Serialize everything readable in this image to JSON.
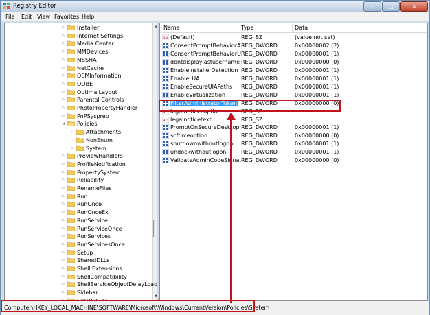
{
  "window": {
    "title": "Registry Editor"
  },
  "menu": [
    "File",
    "Edit",
    "View",
    "Favorites",
    "Help"
  ],
  "tree": [
    {
      "label": "Installer",
      "level": 0
    },
    {
      "label": "Internet Settings",
      "level": 0
    },
    {
      "label": "Media Center",
      "level": 0
    },
    {
      "label": "MMDevices",
      "level": 0
    },
    {
      "label": "MSSHA",
      "level": 0
    },
    {
      "label": "NetCache",
      "level": 0
    },
    {
      "label": "OEMInformation",
      "level": 0
    },
    {
      "label": "OOBE",
      "level": 0
    },
    {
      "label": "OptimalLayout",
      "level": 0
    },
    {
      "label": "Parental Controls",
      "level": 0
    },
    {
      "label": "PhotoPropertyHandler",
      "level": 0
    },
    {
      "label": "PnPSysprep",
      "level": 0
    },
    {
      "label": "Policies",
      "level": 0,
      "expanded": true
    },
    {
      "label": "Attachments",
      "level": 1
    },
    {
      "label": "NonEnum",
      "level": 1
    },
    {
      "label": "System",
      "level": 1
    },
    {
      "label": "PreviewHandlers",
      "level": 0
    },
    {
      "label": "ProfileNotification",
      "level": 0
    },
    {
      "label": "PropertySystem",
      "level": 0
    },
    {
      "label": "Reliability",
      "level": 0
    },
    {
      "label": "RenameFiles",
      "level": 0
    },
    {
      "label": "Run",
      "level": 0
    },
    {
      "label": "RunOnce",
      "level": 0
    },
    {
      "label": "RunOnceEx",
      "level": 0
    },
    {
      "label": "RunService",
      "level": 0
    },
    {
      "label": "RunServiceOnce",
      "level": 0
    },
    {
      "label": "RunServices",
      "level": 0
    },
    {
      "label": "RunServicesOnce",
      "level": 0
    },
    {
      "label": "Setup",
      "level": 0
    },
    {
      "label": "SharedDLLs",
      "level": 0
    },
    {
      "label": "Shell Extensions",
      "level": 0
    },
    {
      "label": "ShellCompatibility",
      "level": 0
    },
    {
      "label": "ShellServiceObjectDelayLoad",
      "level": 0
    },
    {
      "label": "Sidebar",
      "level": 0
    },
    {
      "label": "SideBySide",
      "level": 0
    }
  ],
  "columns": [
    "Name",
    "Type",
    "Data"
  ],
  "values": [
    {
      "name": "(Default)",
      "type": "REG_SZ",
      "data": "(value not set)",
      "icon": "string-value-icon"
    },
    {
      "name": "ConsentPromptBehaviorA...",
      "type": "REG_DWORD",
      "data": "0x00000002 (2)",
      "icon": "dword-value-icon"
    },
    {
      "name": "ConsentPromptBehaviorU...",
      "type": "REG_DWORD",
      "data": "0x00000001 (1)",
      "icon": "dword-value-icon"
    },
    {
      "name": "dontdisplaylastusername",
      "type": "REG_DWORD",
      "data": "0x00000000 (0)",
      "icon": "dword-value-icon"
    },
    {
      "name": "EnableInstallerDetection",
      "type": "REG_DWORD",
      "data": "0x00000001 (1)",
      "icon": "dword-value-icon"
    },
    {
      "name": "EnableLUA",
      "type": "REG_DWORD",
      "data": "0x00000001 (1)",
      "icon": "dword-value-icon"
    },
    {
      "name": "EnableSecureUIAPaths",
      "type": "REG_DWORD",
      "data": "0x00000001 (1)",
      "icon": "dword-value-icon"
    },
    {
      "name": "EnableVirtualization",
      "type": "REG_DWORD",
      "data": "0x00000001 (1)",
      "icon": "dword-value-icon"
    },
    {
      "name": "FilterAdministratorToken",
      "type": "REG_DWORD",
      "data": "0x00000000 (0)",
      "icon": "dword-value-icon",
      "selected": true
    },
    {
      "name": "legalnoticecaption",
      "type": "REG_SZ",
      "data": "",
      "icon": "string-value-icon"
    },
    {
      "name": "legalnoticetext",
      "type": "REG_SZ",
      "data": "",
      "icon": "string-value-icon"
    },
    {
      "name": "PromptOnSecureDesktop",
      "type": "REG_DWORD",
      "data": "0x00000001 (1)",
      "icon": "dword-value-icon"
    },
    {
      "name": "scforceoption",
      "type": "REG_DWORD",
      "data": "0x00000000 (0)",
      "icon": "dword-value-icon"
    },
    {
      "name": "shutdownwithoutlogon",
      "type": "REG_DWORD",
      "data": "0x00000001 (1)",
      "icon": "dword-value-icon"
    },
    {
      "name": "undockwithoutlogon",
      "type": "REG_DWORD",
      "data": "0x00000001 (1)",
      "icon": "dword-value-icon"
    },
    {
      "name": "ValidateAdminCodeSigna...",
      "type": "REG_DWORD",
      "data": "0x00000000 (0)",
      "icon": "dword-value-icon"
    }
  ],
  "status": "Computer\\HKEY_LOCAL_MACHINE\\SOFTWARE\\Microsoft\\Windows\\CurrentVersion\\Policies\\System",
  "colors": {
    "annotation": "#c0141c",
    "selection": "#3399ff",
    "folder": "#f2cc5a"
  }
}
